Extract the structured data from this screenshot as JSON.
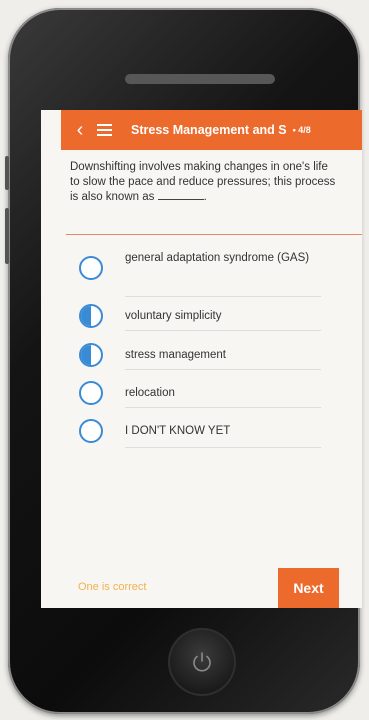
{
  "header": {
    "title": "Stress Management and S",
    "progress": "• 4/8"
  },
  "question": {
    "text": "Downshifting involves making changes in one's life to slow the pace and reduce pressures; this process is also known as",
    "suffix": "."
  },
  "options": [
    {
      "label": "general adaptation syndrome (GAS)",
      "state": "empty"
    },
    {
      "label": "voluntary simplicity",
      "state": "half"
    },
    {
      "label": "stress management",
      "state": "half"
    },
    {
      "label": "relocation",
      "state": "empty"
    },
    {
      "label": "I DON'T KNOW YET",
      "state": "empty"
    }
  ],
  "footer": {
    "hint": "One is correct",
    "next_label": "Next"
  },
  "colors": {
    "accent": "#ec6a2c",
    "radio": "#3a8bd6",
    "hint": "#f1b24d"
  }
}
